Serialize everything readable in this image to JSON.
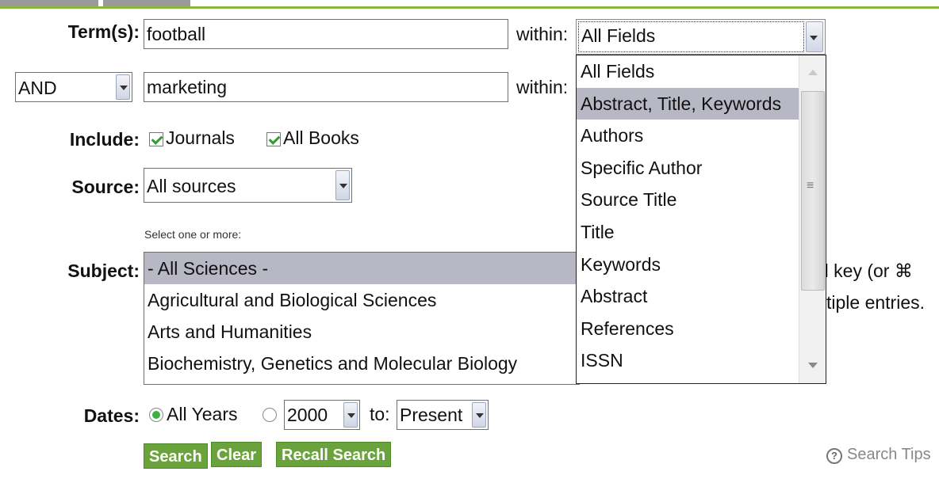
{
  "terms": {
    "label": "Term(s):",
    "value1": "football",
    "within_label": "within:",
    "within_value": "All Fields",
    "operator": "AND",
    "value2": "marketing"
  },
  "include": {
    "label": "Include:",
    "journals": "Journals",
    "books": "All Books"
  },
  "source": {
    "label": "Source:",
    "value": "All sources"
  },
  "subject": {
    "hint": "Select one or more:",
    "label": "Subject:",
    "items": [
      "- All Sciences -",
      "Agricultural and Biological Sciences",
      "Arts and Humanities",
      "Biochemistry, Genetics and Molecular Biology"
    ],
    "note_line1": "rl key (or ⌘",
    "note_line2": "tiple entries."
  },
  "within_dropdown": {
    "options": [
      "All Fields",
      "Abstract, Title, Keywords",
      "Authors",
      "Specific Author",
      "Source Title",
      "Title",
      "Keywords",
      "Abstract",
      "References",
      "ISSN"
    ],
    "highlighted": "Abstract, Title, Keywords"
  },
  "dates": {
    "label": "Dates:",
    "all_years": "All Years",
    "from_value": "2000",
    "to_label": "to:",
    "to_value": "Present"
  },
  "buttons": {
    "search": "Search",
    "clear": "Clear",
    "recall": "Recall Search"
  },
  "search_tips": "Search Tips",
  "icons": {
    "tips_icon": "?",
    "scroll_grip": "≡"
  },
  "colors": {
    "accent_green": "#6aa33b",
    "highlight": "#b8b8c4"
  }
}
